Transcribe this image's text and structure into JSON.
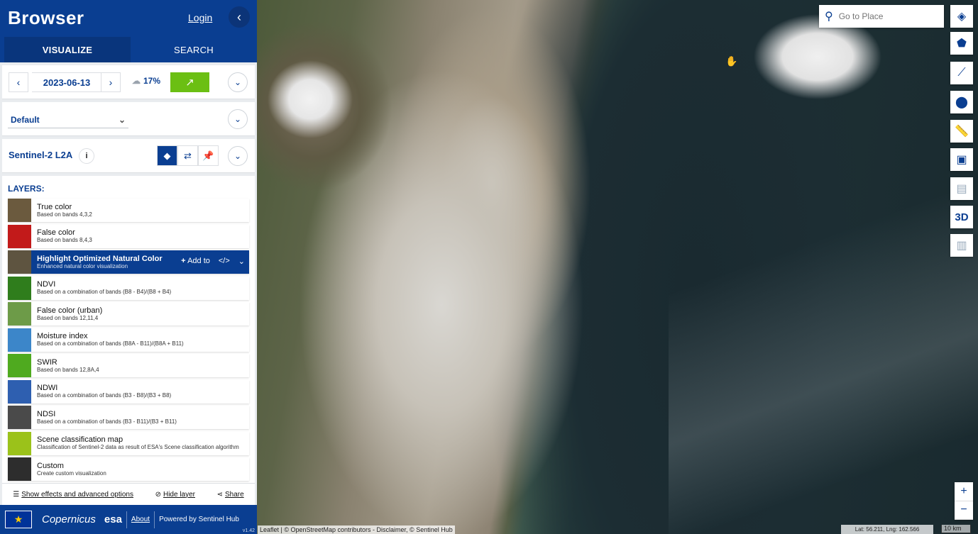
{
  "header": {
    "title": "Browser",
    "login_label": "Login",
    "collapse_icon": "chevron-left-icon"
  },
  "tabs": [
    {
      "label": "VISUALIZE",
      "active": true
    },
    {
      "label": "SEARCH",
      "active": false
    }
  ],
  "date_picker": {
    "date": "2023-06-13",
    "cloud_coverage": "17%"
  },
  "theme": {
    "selected": "Default"
  },
  "dataset": {
    "name": "Sentinel-2 L2A",
    "info": "i"
  },
  "layers_title": "LAYERS:",
  "layers": [
    {
      "title": "True color",
      "desc": "Based on bands 4,3,2",
      "thumb": "#6b5a3e"
    },
    {
      "title": "False color",
      "desc": "Based on bands 8,4,3",
      "thumb": "#c21a1a"
    },
    {
      "title": "Highlight Optimized Natural Color",
      "desc": "Enhanced natural color visualization",
      "thumb": "#5e5440",
      "active": true
    },
    {
      "title": "NDVI",
      "desc": "Based on a combination of bands (B8 - B4)/(B8 + B4)",
      "thumb": "#2f7d1c"
    },
    {
      "title": "False color (urban)",
      "desc": "Based on bands 12,11,4",
      "thumb": "#6d9b48"
    },
    {
      "title": "Moisture index",
      "desc": "Based on a combination of bands (B8A - B11)/(B8A + B11)",
      "thumb": "#3c86c9"
    },
    {
      "title": "SWIR",
      "desc": "Based on bands 12,8A,4",
      "thumb": "#4faa1f"
    },
    {
      "title": "NDWI",
      "desc": "Based on a combination of bands (B3 - B8)/(B3 + B8)",
      "thumb": "#2e5fb0"
    },
    {
      "title": "NDSI",
      "desc": "Based on a combination of bands (B3 - B11)/(B3 + B11)",
      "thumb": "#4a4a4a"
    },
    {
      "title": "Scene classification map",
      "desc": "Classification of Sentinel-2 data as result of ESA's Scene classification algorithm",
      "thumb": "#9bc21a"
    },
    {
      "title": "Custom",
      "desc": "Create custom visualization",
      "thumb": "#2d2d2d"
    }
  ],
  "active_layer_actions": {
    "add_to": "Add to",
    "code": "</>"
  },
  "bottom_bar": {
    "effects": "Show effects and advanced options",
    "hide": "Hide layer",
    "share": "Share"
  },
  "footer": {
    "eu": "★",
    "copernicus": "opernicus",
    "esa": "esa",
    "about": "About",
    "powered": "Powered by Sentinel Hub",
    "version": "v1.42"
  },
  "map": {
    "search_placeholder": "Go to Place",
    "controls": [
      "layers-icon",
      "polygon-icon",
      "line-icon",
      "marker-icon",
      "ruler-icon",
      "image-download-icon",
      "film-icon",
      "3d-icon",
      "chart-icon"
    ],
    "control_3d_label": "3D",
    "attribution": "Leaflet | © OpenStreetMap contributors - Disclaimer, © Sentinel Hub",
    "coords": "Lat: 56.211, Lng: 162.566",
    "scale": "10 km"
  }
}
